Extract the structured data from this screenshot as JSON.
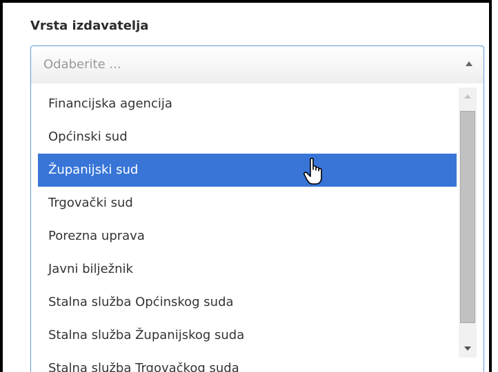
{
  "field": {
    "label": "Vrsta izdavatelja",
    "placeholder": "Odaberite ..."
  },
  "options": [
    "Financijska agencija",
    "Općinski sud",
    "Županijski sud",
    "Trgovački sud",
    "Porezna uprava",
    "Javni bilježnik",
    "Stalna služba Općinskog suda",
    "Stalna služba Županijskog suda",
    "Stalna služba Trgovačkog suda"
  ],
  "selected_option": "Županijski sud",
  "icons": {
    "select_arrow": "chevron-up-icon",
    "cursor": "hand-pointer-icon"
  },
  "colors": {
    "highlight": "#3875d7",
    "focus_border": "#5b9bd5"
  }
}
